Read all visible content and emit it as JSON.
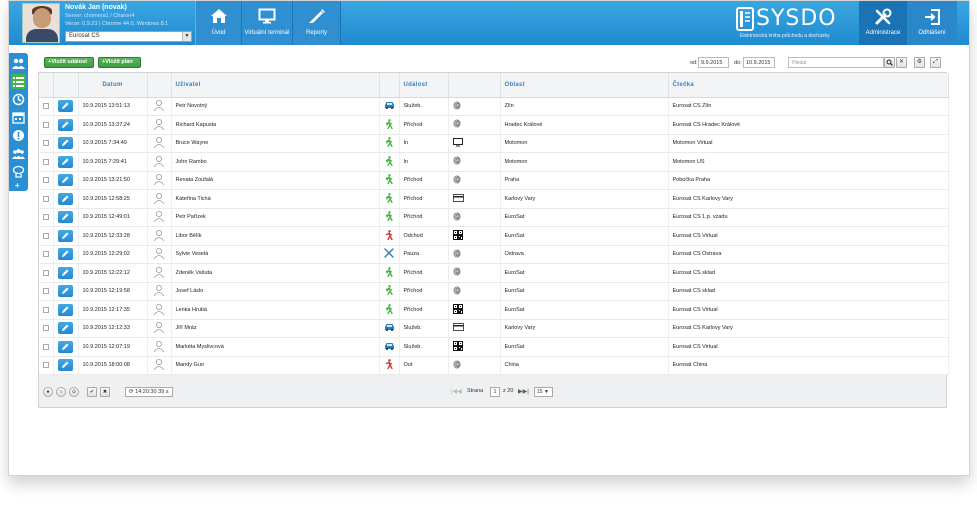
{
  "header": {
    "user_name": "Novák Jan (novak)",
    "server_line": "Server: chomera1 / Charon4",
    "version_line": "Verze: 0.9.23 | Chrome 44.0, Windows 8.1",
    "company": "Eurosat CS",
    "nav": {
      "home": "Úvod",
      "terminal": "Virtuální terminál",
      "reports": "Reporty",
      "admin": "Administrace",
      "logout": "Odhlášení"
    },
    "logo_text": "SYSDO",
    "logo_sub": "Elektronická kniha průchodu a docházky",
    "brand_color": "#2a8fd3"
  },
  "toolbar": {
    "add_event": "+Vložit událost",
    "add_plan": "+Vložit plán",
    "from_label": "od:",
    "from_value": "9.9.2015",
    "to_label": "do:",
    "to_value": "10.9.2015",
    "search_placeholder": "Hledat"
  },
  "table": {
    "headers": {
      "date": "Datum",
      "user": "Uživatel",
      "event": "Událost",
      "area": "Oblast",
      "reader": "Čtečka"
    },
    "rows": [
      {
        "date": "10.9.2015 13:51:13",
        "user": "Petr Novotný",
        "event_icon": "car-icon",
        "event": "Služeb.",
        "method_icon": "fingerprint-icon",
        "area": "Zlín",
        "reader": "Eurosat CS Zlín"
      },
      {
        "date": "10.9.2015 13:37:24",
        "user": "Richard Kapusta",
        "event_icon": "walk-in-icon",
        "event": "Příchod",
        "method_icon": "fingerprint-icon",
        "area": "Hradec Králové",
        "reader": "Eurosat CS Hradec Králové"
      },
      {
        "date": "10.9.2015 7:34:49",
        "user": "Bruce Wayne",
        "event_icon": "walk-in-icon",
        "event": "In",
        "method_icon": "monitor-icon",
        "area": "Motomon",
        "reader": "Motomon Virtual"
      },
      {
        "date": "10.9.2015 7:29:41",
        "user": "John Rambo",
        "event_icon": "walk-in-icon",
        "event": "In",
        "method_icon": "fingerprint-icon",
        "area": "Motomon",
        "reader": "Motomon US"
      },
      {
        "date": "10.9.2015 13:21:50",
        "user": "Renata Zoufalá",
        "event_icon": "walk-in-icon",
        "event": "Příchod",
        "method_icon": "fingerprint-icon",
        "area": "Praha",
        "reader": "Pobočka Praha"
      },
      {
        "date": "10.9.2015 12:58:25",
        "user": "Kateřina Tichá",
        "event_icon": "walk-in-icon",
        "event": "Příchod",
        "method_icon": "card-icon",
        "area": "Karlovy Vary",
        "reader": "Eurosat CS Karlovy Vary"
      },
      {
        "date": "10.9.2015 12:49:01",
        "user": "Petr Pařízek",
        "event_icon": "walk-in-icon",
        "event": "Příchod",
        "method_icon": "fingerprint-icon",
        "area": "EuroSat",
        "reader": "Eurosat CS 1.p. vzadu"
      },
      {
        "date": "10.9.2015 12:33:28",
        "user": "Libor Bělík",
        "event_icon": "walk-out-icon",
        "event": "Odchod",
        "method_icon": "qr-code-icon",
        "area": "EuroSat",
        "reader": "Eurosat CS Virtual"
      },
      {
        "date": "10.9.2015 12:29:02",
        "user": "Sylvie Veselá",
        "event_icon": "cutlery-icon",
        "event": "Pauza",
        "method_icon": "fingerprint-icon",
        "area": "Ostrava",
        "reader": "Eurosat CS Ostrava"
      },
      {
        "date": "10.9.2015 12:22:12",
        "user": "Zdeněk Vašuta",
        "event_icon": "walk-in-icon",
        "event": "Příchod",
        "method_icon": "fingerprint-icon",
        "area": "EuroSat",
        "reader": "Eurosat CS sklad"
      },
      {
        "date": "10.9.2015 12:19:58",
        "user": "Josef Láslo",
        "event_icon": "walk-in-icon",
        "event": "Příchod",
        "method_icon": "fingerprint-icon",
        "area": "EuroSat",
        "reader": "Eurosat CS sklad"
      },
      {
        "date": "10.9.2015 12:17:35",
        "user": "Lenka Hrubá",
        "event_icon": "walk-in-icon",
        "event": "Příchod",
        "method_icon": "qr-code-icon",
        "area": "EuroSat",
        "reader": "Eurosat CS Virtual"
      },
      {
        "date": "10.9.2015 12:12:33",
        "user": "Jiří Mráz",
        "event_icon": "car-icon",
        "event": "Služeb.",
        "method_icon": "card-icon",
        "area": "Karlovy Vary",
        "reader": "Eurosat CS Karlovy Vary"
      },
      {
        "date": "10.9.2015 12:07:19",
        "user": "Markéta Myslivcová",
        "event_icon": "car-icon",
        "event": "Služeb.",
        "method_icon": "qr-code-icon",
        "area": "EuroSat",
        "reader": "Eurosat CS Virtual"
      },
      {
        "date": "10.9.2015 18:00:08",
        "user": "Mandy Guo",
        "event_icon": "walk-out-icon",
        "event": "Out",
        "method_icon": "fingerprint-icon",
        "area": "China",
        "reader": "Eurosat China"
      }
    ]
  },
  "pager": {
    "refresh_time": "14:20:30",
    "refresh_interval": "39 s",
    "page_label": "Strana",
    "page_value": "1",
    "of_label": "z 20",
    "page_size": "15"
  },
  "colors": {
    "walk_in": "#3fb33f",
    "walk_out": "#d42a2a",
    "car": "#2a7fb8",
    "pause": "#2a7fb8",
    "header_text": "#3b7fc0"
  }
}
